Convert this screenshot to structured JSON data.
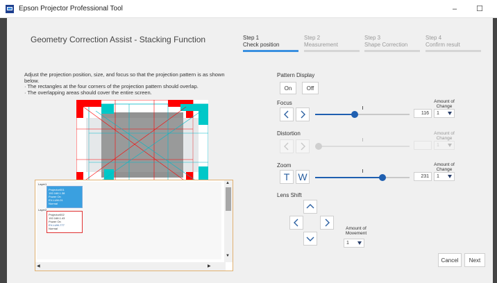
{
  "window": {
    "title": "Epson Projector Professional Tool",
    "minimize_glyph": "–",
    "maximize_glyph": "☐"
  },
  "page": {
    "title": "Geometry Correction Assist - Stacking Function"
  },
  "steps": [
    {
      "num": "Step 1",
      "name": "Check position",
      "active": true
    },
    {
      "num": "Step 2",
      "name": "Measurement",
      "active": false
    },
    {
      "num": "Step 3",
      "name": "Shape Correction",
      "active": false
    },
    {
      "num": "Step 4",
      "name": "Confirm result",
      "active": false
    }
  ],
  "instructions": {
    "line1": "Adjust the projection position, size, and focus so that the projection pattern is as shown below.",
    "line2": "· The rectangles at the four corners of the projection pattern should overlap.",
    "line3": "· The overlapping areas should cover the entire screen."
  },
  "layout": {
    "group_label_1": "Layer1",
    "proj1_name": "Projector001",
    "proj1_ip": "192.168.1.38",
    "proj1_status1": "Power On",
    "proj1_status2": "EV-LUM-01",
    "proj1_state": "Normal",
    "group_label_2": "Layer2",
    "proj2_name": "Projector002",
    "proj2_ip": "192.168.1.43",
    "proj2_status1": "Power On",
    "proj2_status2": "EV-LUM-777",
    "proj2_state": "Normal"
  },
  "pattern_display": {
    "label": "Pattern Display",
    "on_label": "On",
    "off_label": "Off"
  },
  "focus": {
    "label": "Focus",
    "value": "116",
    "level": 0.41,
    "amount_label": "Amount of Change",
    "amount_value": "1"
  },
  "distortion": {
    "label": "Distortion",
    "value": "",
    "level": 0.0,
    "amount_label": "Amount of Change",
    "amount_value": "1"
  },
  "zoom": {
    "label": "Zoom",
    "tele_label": "T",
    "wide_label": "W",
    "value": "231",
    "level": 0.73,
    "amount_label": "Amount of Change",
    "amount_value": "1"
  },
  "lens_shift": {
    "label": "Lens Shift",
    "amount_label": "Amount of Movement",
    "amount_value": "1"
  },
  "footer": {
    "cancel_label": "Cancel",
    "next_label": "Next"
  },
  "colors": {
    "accent": "#3a8fe0",
    "slider": "#1f5fb0",
    "pattern_red": "#ff0000",
    "pattern_cyan": "#00c8c8"
  }
}
